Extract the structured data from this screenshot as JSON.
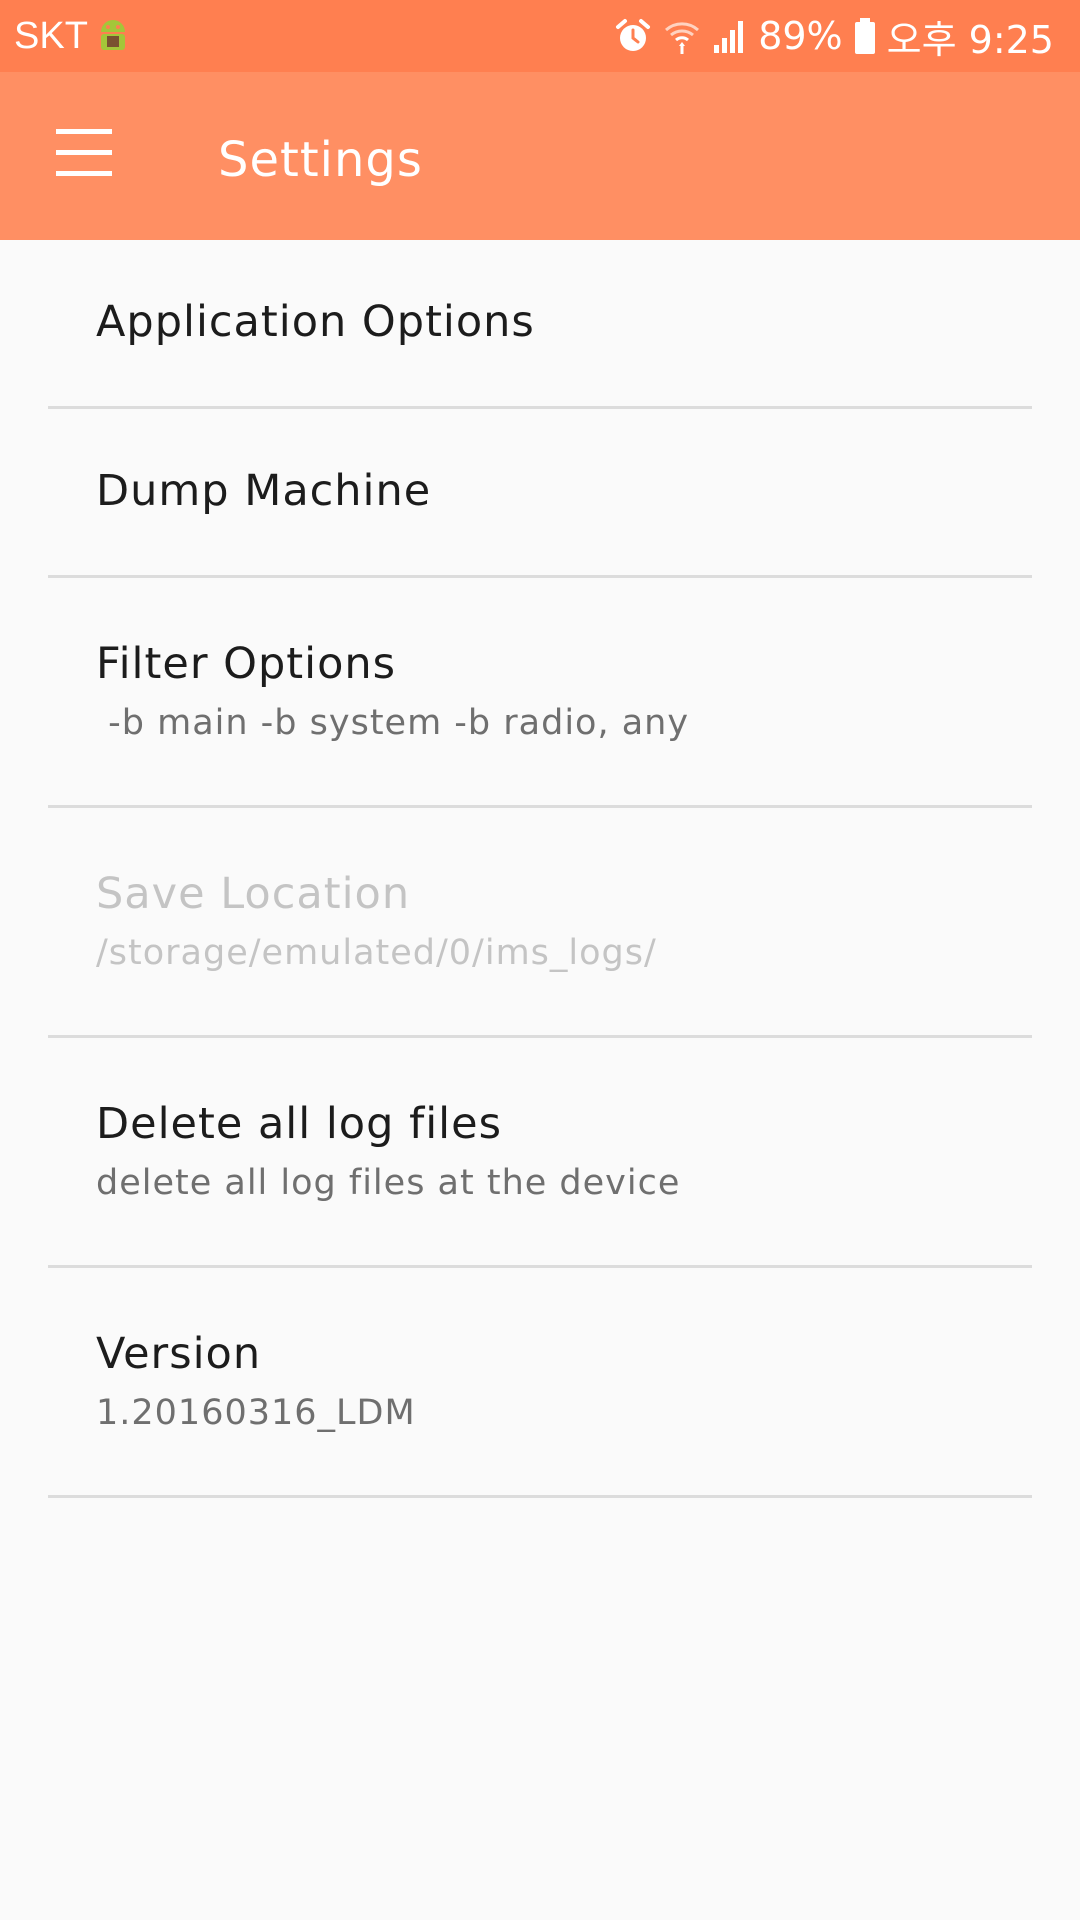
{
  "status_bar": {
    "carrier": "SKT",
    "battery": "89%",
    "time": "오후 9:25"
  },
  "app_bar": {
    "title": "Settings"
  },
  "preferences": [
    {
      "title": "Application Options",
      "summary": ""
    },
    {
      "title": "Dump Machine",
      "summary": ""
    },
    {
      "title": "Filter Options",
      "summary": " -b main -b system -b radio, any"
    },
    {
      "title": "Save Location",
      "summary": "/storage/emulated/0/ims_logs/"
    },
    {
      "title": "Delete all log files",
      "summary": "delete all log files at the device"
    },
    {
      "title": "Version",
      "summary": "1.20160316_LDM"
    }
  ],
  "colors": {
    "status_bar": "#ff7f50",
    "app_bar": "#ff8f63",
    "background": "#fafafa",
    "divider": "#dcdcdc"
  }
}
